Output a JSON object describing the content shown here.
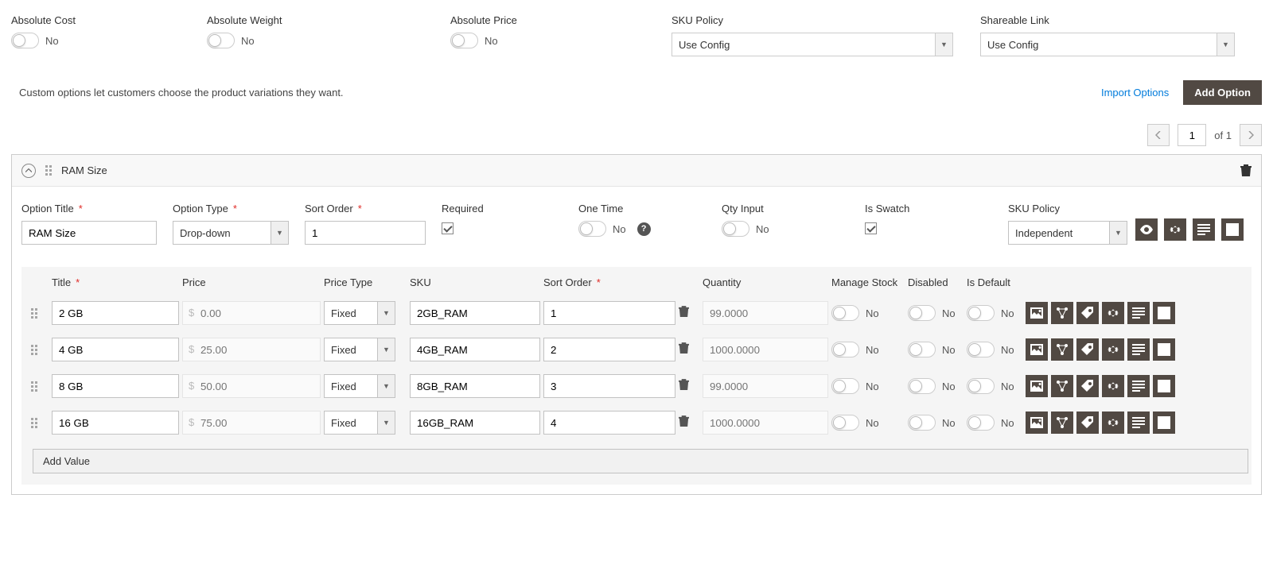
{
  "top": {
    "abs_cost_label": "Absolute Cost",
    "abs_cost_value": "No",
    "abs_weight_label": "Absolute Weight",
    "abs_weight_value": "No",
    "abs_price_label": "Absolute Price",
    "abs_price_value": "No",
    "sku_policy_label": "SKU Policy",
    "sku_policy_value": "Use Config",
    "shareable_link_label": "Shareable Link",
    "shareable_link_value": "Use Config"
  },
  "desc_text": "Custom options let customers choose the product variations they want.",
  "import_options_label": "Import Options",
  "add_option_label": "Add Option",
  "pager": {
    "page": "1",
    "of_label": "of",
    "total": "1"
  },
  "option": {
    "header_title": "RAM Size",
    "title_label": "Option Title",
    "title_value": "RAM Size",
    "type_label": "Option Type",
    "type_value": "Drop-down",
    "sort_label": "Sort Order",
    "sort_value": "1",
    "required_label": "Required",
    "one_time_label": "One Time",
    "one_time_value": "No",
    "qty_input_label": "Qty Input",
    "qty_input_value": "No",
    "is_swatch_label": "Is Swatch",
    "sku_policy_label": "SKU Policy",
    "sku_policy_value": "Independent"
  },
  "columns": {
    "title": "Title",
    "price": "Price",
    "price_type": "Price Type",
    "sku": "SKU",
    "sort_order": "Sort Order",
    "quantity": "Quantity",
    "manage_stock": "Manage Stock",
    "disabled": "Disabled",
    "is_default": "Is Default"
  },
  "rows": [
    {
      "title": "2 GB",
      "price": "0.00",
      "price_type": "Fixed",
      "sku": "2GB_RAM",
      "sort": "1",
      "qty": "99.0000",
      "ms": "No",
      "dis": "No",
      "def": "No"
    },
    {
      "title": "4 GB",
      "price": "25.00",
      "price_type": "Fixed",
      "sku": "4GB_RAM",
      "sort": "2",
      "qty": "1000.0000",
      "ms": "No",
      "dis": "No",
      "def": "No"
    },
    {
      "title": "8 GB",
      "price": "50.00",
      "price_type": "Fixed",
      "sku": "8GB_RAM",
      "sort": "3",
      "qty": "99.0000",
      "ms": "No",
      "dis": "No",
      "def": "No"
    },
    {
      "title": "16 GB",
      "price": "75.00",
      "price_type": "Fixed",
      "sku": "16GB_RAM",
      "sort": "4",
      "qty": "1000.0000",
      "ms": "No",
      "dis": "No",
      "def": "No"
    }
  ],
  "add_value_label": "Add Value",
  "price_symbol": "$"
}
